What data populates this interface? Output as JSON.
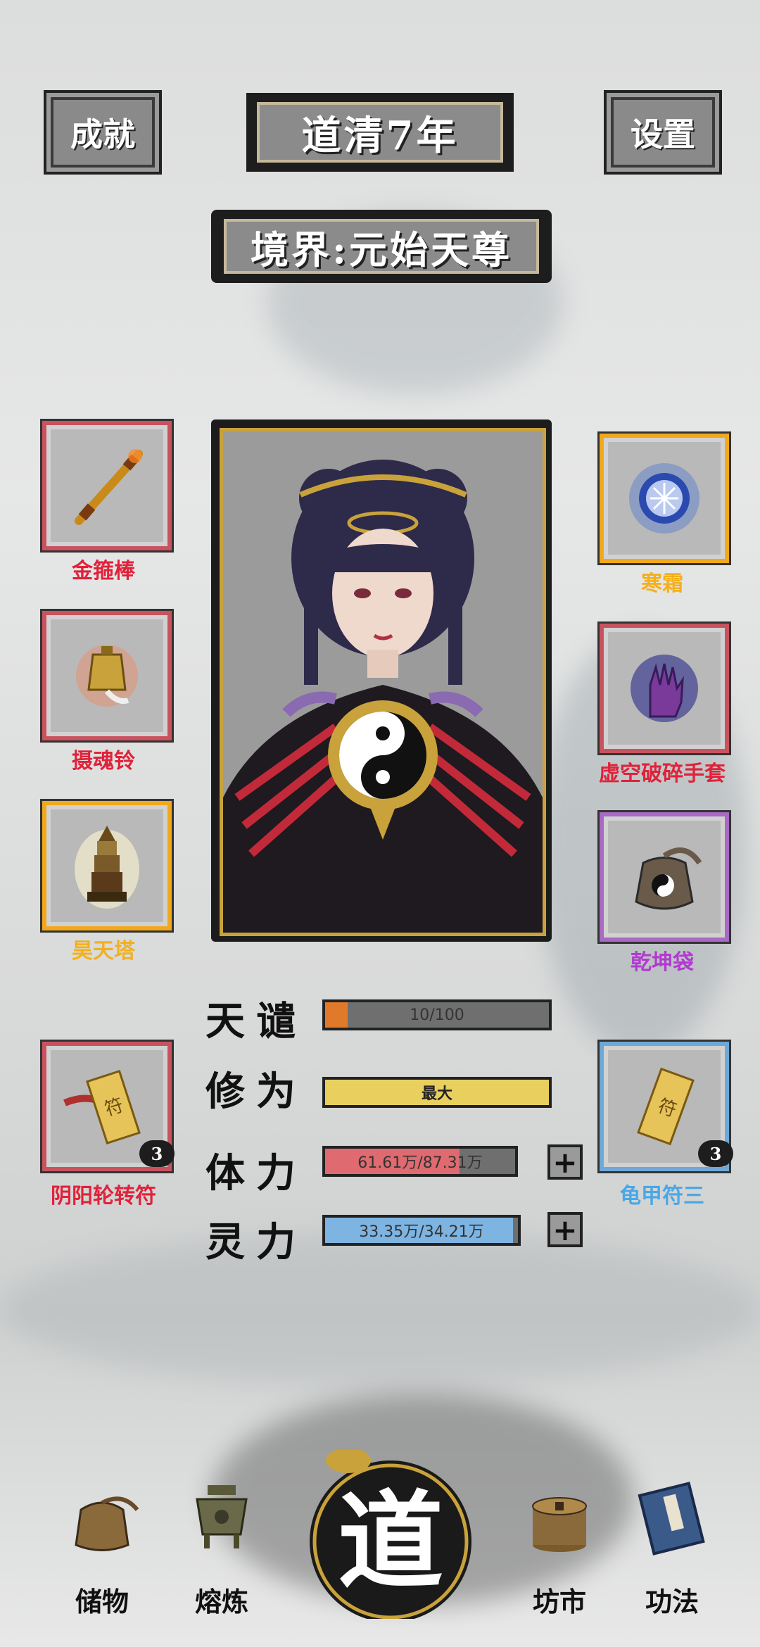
{
  "header": {
    "achievements_label": "成就",
    "year_label": "道清7年",
    "settings_label": "设置",
    "realm_label": "境界:元始天尊"
  },
  "equipment_left": [
    {
      "name": "金箍棒",
      "color": "#e0223a",
      "icon": "staff-icon"
    },
    {
      "name": "摄魂铃",
      "color": "#e0223a",
      "icon": "bell-icon"
    },
    {
      "name": "昊天塔",
      "color": "#f2b01e",
      "icon": "pagoda-icon"
    },
    {
      "name": "阴阳轮转符",
      "color": "#e0223a",
      "icon": "talisman-icon",
      "count": "3"
    }
  ],
  "equipment_right": [
    {
      "name": "寒霜",
      "color": "#f2b01e",
      "icon": "frost-orb-icon"
    },
    {
      "name": "虚空破碎手套",
      "color": "#e0223a",
      "icon": "glove-icon"
    },
    {
      "name": "乾坤袋",
      "color": "#b23ad0",
      "icon": "bag-icon"
    },
    {
      "name": "龟甲符三",
      "color": "#4aa7e6",
      "icon": "talisman-icon",
      "count": "3"
    }
  ],
  "stats": {
    "tianqian": {
      "label": "天谴",
      "value": "10/100",
      "fraction": 0.1,
      "color": "#e07a2a"
    },
    "xiuwei": {
      "label": "修为",
      "value": "最大",
      "fraction": 1.0,
      "color": "#e9cf5e"
    },
    "tili": {
      "label": "体力",
      "value": "61.61万/87.31万",
      "fraction": 0.706,
      "color": "#df6a6f"
    },
    "lingli": {
      "label": "灵力",
      "value": "33.35万/34.21万",
      "fraction": 0.975,
      "color": "#7db4e2"
    }
  },
  "nav": {
    "storage": "储物",
    "smelting": "熔炼",
    "dao": "道",
    "market": "坊市",
    "skills": "功法"
  }
}
